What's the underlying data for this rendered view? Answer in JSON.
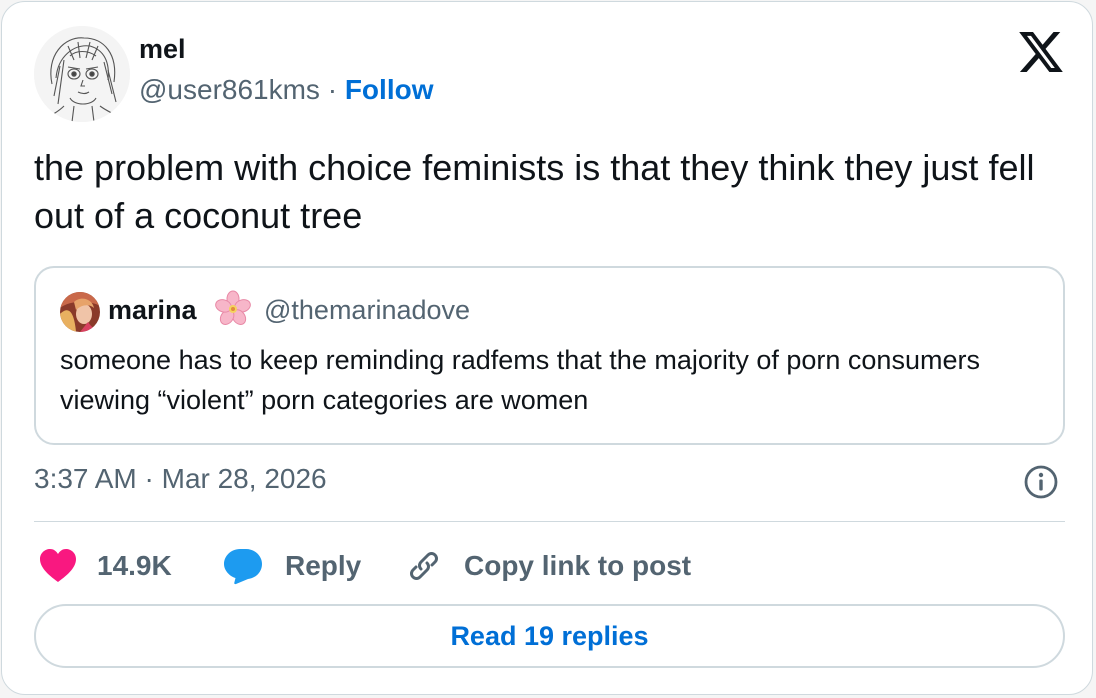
{
  "author": {
    "display_name": "mel",
    "handle": "@user861kms",
    "separator": "·",
    "follow_label": "Follow"
  },
  "brand": {
    "logo_icon": "x-logo-icon"
  },
  "tweet": {
    "text": "the problem with choice feminists is that they think they just fell out of a coconut tree"
  },
  "quoted_tweet": {
    "display_name": "marina",
    "name_emoji_icon": "cherry-blossom-icon",
    "handle": "@themarinadove",
    "text": "someone has to keep reminding radfems that the majority of porn consumers viewing “violent” porn categories are women"
  },
  "timestamp": "3:37 AM · Mar 28, 2026",
  "actions": {
    "like_count": "14.9K",
    "reply_label": "Reply",
    "copy_link_label": "Copy link to post"
  },
  "read_replies_label": "Read 19 replies",
  "colors": {
    "accent": "#006fd6",
    "text": "#0f1419",
    "secondary": "#536471",
    "border": "#cfd9de",
    "heart": "#f91880",
    "reply_bubble": "#1d9bf0"
  }
}
